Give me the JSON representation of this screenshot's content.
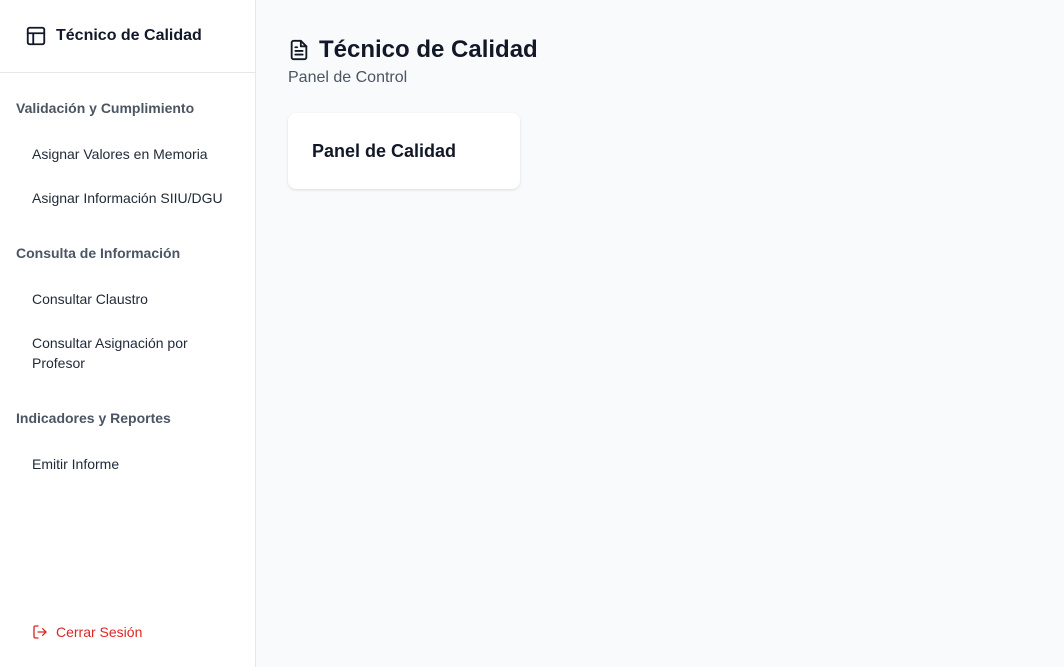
{
  "sidebar": {
    "brand": {
      "title": "Técnico de Calidad",
      "icon": "layout-panel-icon"
    },
    "sections": [
      {
        "title": "Validación y Cumplimiento",
        "items": [
          {
            "label": "Asignar Valores en Memoria"
          },
          {
            "label": "Asignar Información SIIU/DGU"
          }
        ]
      },
      {
        "title": "Consulta de Información",
        "items": [
          {
            "label": "Consultar Claustro"
          },
          {
            "label": "Consultar Asignación por Profesor"
          }
        ]
      },
      {
        "title": "Indicadores y Reportes",
        "items": [
          {
            "label": "Emitir Informe"
          }
        ]
      }
    ],
    "logout": {
      "label": "Cerrar Sesión",
      "icon": "logout-icon",
      "color": "#dc2626"
    }
  },
  "main": {
    "title": "Técnico de Calidad",
    "title_icon": "document-icon",
    "subtitle": "Panel de Control",
    "cards": [
      {
        "title": "Panel de Calidad"
      }
    ]
  },
  "colors": {
    "sidebar_bg": "#ffffff",
    "main_bg": "#f9fafb",
    "danger": "#dc2626",
    "text": "#111827",
    "muted": "#4b5563"
  }
}
